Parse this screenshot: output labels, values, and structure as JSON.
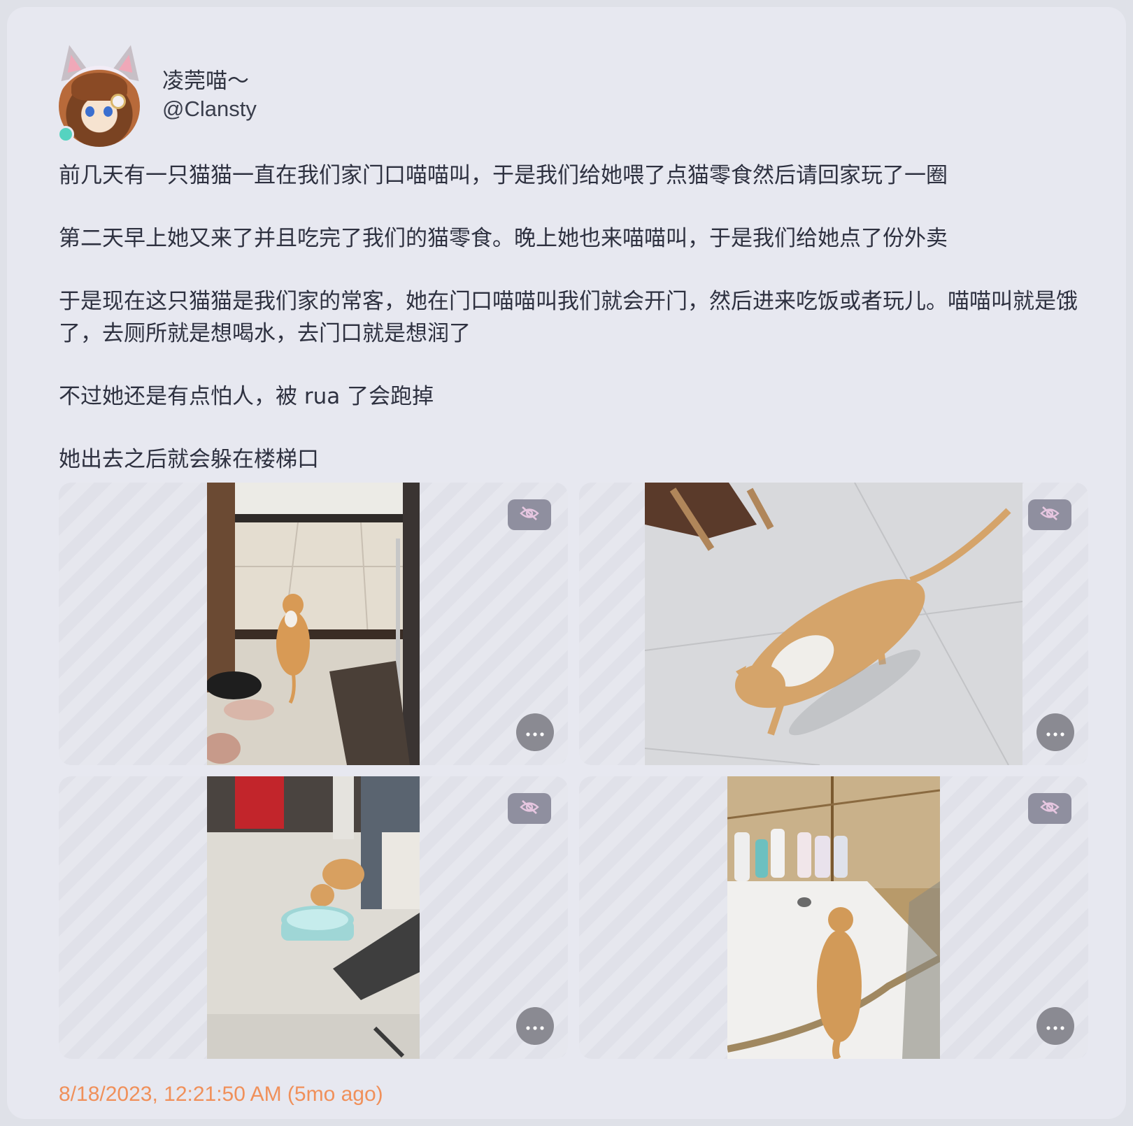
{
  "user": {
    "display_name": "凌莞喵～",
    "handle": "@Clansty",
    "online": true
  },
  "post": {
    "paragraphs": [
      "前几天有一只猫猫一直在我们家门口喵喵叫，于是我们给她喂了点猫零食然后请回家玩了一圈",
      "第二天早上她又来了并且吃完了我们的猫零食。晚上她也来喵喵叫，于是我们给她点了份外卖",
      "于是现在这只猫猫是我们家的常客，她在门口喵喵叫我们就会开门，然后进来吃饭或者玩儿。喵喵叫就是饿了，去厕所就是想喝水，去门口就是想润了",
      "不过她还是有点怕人，被 rua 了会跑掉",
      "她出去之后就会躲在楼梯口"
    ],
    "timestamp": "8/18/2023, 12:21:50 AM (5mo ago)"
  },
  "media": {
    "items": [
      {
        "subject": "cat-at-door",
        "hide_icon": "eye-slash-icon",
        "more_icon": "more-horizontal-icon"
      },
      {
        "subject": "cat-walking-on-tiles",
        "hide_icon": "eye-slash-icon",
        "more_icon": "more-horizontal-icon"
      },
      {
        "subject": "cat-drinking-from-basin",
        "hide_icon": "eye-slash-icon",
        "more_icon": "more-horizontal-icon"
      },
      {
        "subject": "cat-in-shower",
        "hide_icon": "eye-slash-icon",
        "more_icon": "more-horizontal-icon"
      }
    ]
  },
  "colors": {
    "card_background": "#e7e8f0",
    "text": "#2e3140",
    "timestamp": "#f0905a",
    "online_dot": "#55d3c0",
    "button_bg": "#8f8f9f"
  }
}
